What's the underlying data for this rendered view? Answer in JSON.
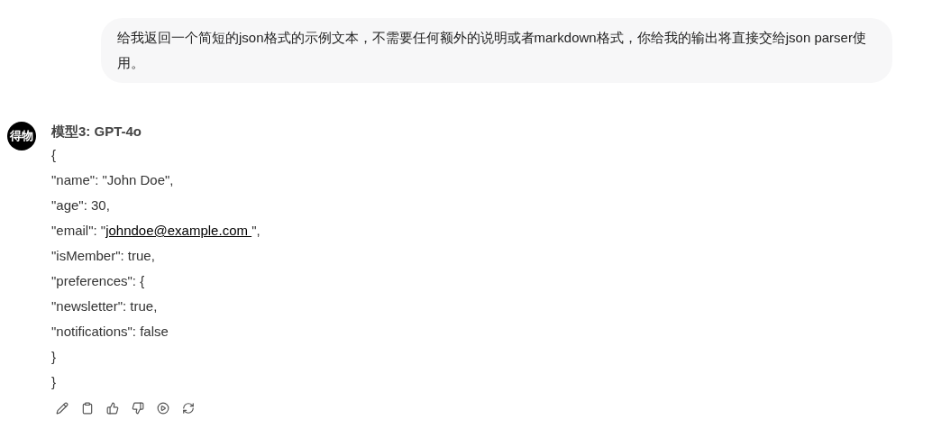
{
  "user_message": "给我返回一个简短的json格式的示例文本，不需要任何额外的说明或者markdown格式，你给我的输出将直接交给json parser使用。",
  "reply": {
    "avatar_text": "得物",
    "model_name": "模型3: GPT-4o",
    "lines": [
      {
        "text": "{"
      },
      {
        "text": "\"name\": \"John Doe\","
      },
      {
        "text": "\"age\": 30,"
      },
      {
        "text": "\"email\": \"",
        "link": "johndoe@example.com ",
        "after": "\","
      },
      {
        "text": "\"isMember\": true,"
      },
      {
        "text": "\"preferences\": {"
      },
      {
        "text": "\"newsletter\": true,"
      },
      {
        "text": "\"notifications\": false"
      },
      {
        "text": "}"
      },
      {
        "text": "}"
      }
    ],
    "actions": [
      {
        "kind": "edit"
      },
      {
        "kind": "copy"
      },
      {
        "kind": "like"
      },
      {
        "kind": "dislike"
      },
      {
        "kind": "play"
      },
      {
        "kind": "regenerate"
      }
    ]
  }
}
